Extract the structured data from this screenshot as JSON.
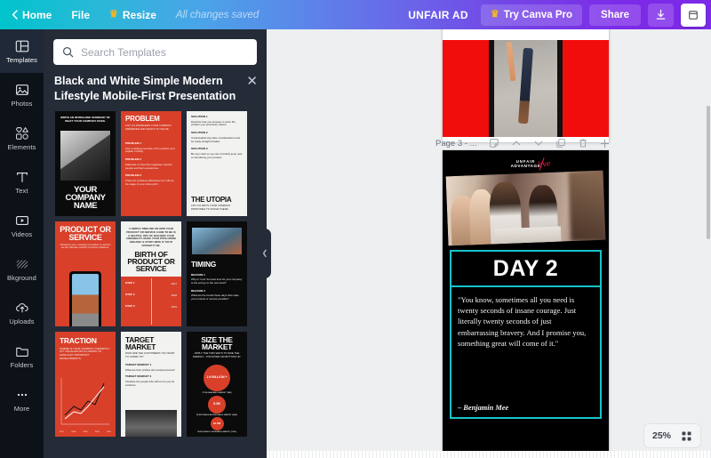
{
  "topbar": {
    "home": "Home",
    "file": "File",
    "resize": "Resize",
    "saved_status": "All changes saved",
    "brand": "UNFAIR AD",
    "try_pro": "Try Canva Pro",
    "share": "Share",
    "crown_icon": "crown-icon",
    "download_icon": "download-icon",
    "back_icon": "chevron-left-icon",
    "more_icon": "window-icon",
    "gradient_start": "#00c4cc",
    "gradient_end": "#7d2ae8"
  },
  "rail": {
    "items": [
      {
        "label": "Templates",
        "icon": "templates-icon",
        "active": true
      },
      {
        "label": "Photos",
        "icon": "photos-icon",
        "active": false
      },
      {
        "label": "Elements",
        "icon": "elements-icon",
        "active": false
      },
      {
        "label": "Text",
        "icon": "text-icon",
        "active": false
      },
      {
        "label": "Videos",
        "icon": "videos-icon",
        "active": false
      },
      {
        "label": "Bkground",
        "icon": "background-icon",
        "active": false
      },
      {
        "label": "Uploads",
        "icon": "uploads-icon",
        "active": false
      },
      {
        "label": "Folders",
        "icon": "folders-icon",
        "active": false
      },
      {
        "label": "More",
        "icon": "more-dots-icon",
        "active": false
      }
    ]
  },
  "panel": {
    "search_placeholder": "Search Templates",
    "search_value": "",
    "search_icon": "search-icon",
    "title": "Black and White Simple Modern Lifestyle Mobile-First Presentation",
    "close_icon": "close-icon",
    "collapse_icon": "chevron-left-icon",
    "templates": [
      {
        "name": "title-slide",
        "style": "black",
        "top_text": "WRITE AN INTRIGUING SUMMARY OF WHAT YOUR COMPANY DOES.",
        "headline": "YOUR COMPANY NAME"
      },
      {
        "name": "problem-slide",
        "style": "red",
        "headline": "PROBLEM",
        "top_text": "LIST 3-5 PROBLEMS YOUR COMPANY OBSERVES AND WANTS TO SOLVE.",
        "items": [
          {
            "label": "PROBLEM 1",
            "body": "Give a striking overview of the problem and explain it briefly."
          },
          {
            "label": "PROBLEM 2",
            "body": "Elaborate on how this negatively impacts people and their experiences."
          },
          {
            "label": "PROBLEM 3",
            "body": "Probe the problems effectively so it will set the stage of your entire pitch."
          }
        ]
      },
      {
        "name": "solution-slide",
        "style": "white",
        "items": [
          {
            "label": "SOLUTION 1",
            "body": "Describe how you propose to solve the problem you previously shared."
          },
          {
            "label": "SOLUTION 2",
            "body": "Contextualize big value considerations and be ready straight forward."
          },
          {
            "label": "SOLUTION 3",
            "body": "Be very clear so you can smoothly jump next to introducing your product."
          }
        ],
        "headline": "THE UTOPIA",
        "bottom_text": "LIST 3-5 WAYS YOUR COMPANY PROPOSES TO SOLVE THESE."
      },
      {
        "name": "product-or-service-slide",
        "style": "red",
        "headline": "PRODUCT OR SERVICE",
        "top_text": "Introduce your company's product or service as the ultimate solution to these problems."
      },
      {
        "name": "birth-of-product-slide",
        "style": "white-red",
        "top_text": "A SIMPLE TIMELINE ON HOW YOUR PRODUCT OR SERVICE CAME TO BE IS A HELPFUL WAY OF BUILDING YOUR CREDIBILITY. MAKE YOUR PITCH MORE ORGANIC & STORY-WISE IF YOU'D RATHER IT BE.",
        "headline": "BIRTH OF PRODUCT OR SERVICE",
        "steps": [
          {
            "label": "STEP 1",
            "year": "2017"
          },
          {
            "label": "STEP 2",
            "year": "2018"
          },
          {
            "label": "STEP 3",
            "year": "2019"
          }
        ]
      },
      {
        "name": "timing-slide",
        "style": "black",
        "headline": "TIMING",
        "items": [
          {
            "label": "REASON 1",
            "body": "Why is \"now\" the best time for your company to the end go to the next level?"
          },
          {
            "label": "REASON 2",
            "body": "What are the trends these days that make your product or service possible?"
          }
        ]
      },
      {
        "name": "traction-slide",
        "style": "red",
        "headline": "TRACTION",
        "top_text": "WHERE IS YOUR COMPANY CURRENTLY AT? VISUALIZE WITH A GRAPH TO HIGHLIGHT IMPORTANT DEVELOPMENTS.",
        "x_labels": [
          "2017",
          "2018",
          "2019",
          "2020",
          "2021"
        ]
      },
      {
        "name": "target-market-slide",
        "style": "white",
        "headline": "TARGET MARKET",
        "top_text": "WHO ARE THE CUSTOMERS YOU WANT TO CATER TO?",
        "items": [
          {
            "label": "TARGET MARKET 1",
            "body": "What are their profiles and usual personas?"
          },
          {
            "label": "TARGET MARKET 2",
            "body": "Visualize the people who will turn to you for solutions."
          }
        ]
      },
      {
        "name": "size-the-market-slide",
        "style": "black",
        "headline": "SIZE THE MARKET",
        "top_text": "APPLY THE TWO WAYS TO SIZE THE MARKET - TOP DOWN OR BOTTOM UP.",
        "bubbles": [
          {
            "value": "1.9 BILLION +",
            "caption": "TOTAL AVAILABLE MARKET (TAM)"
          },
          {
            "value": "8.2M",
            "caption": "SERVICEABLE ADDRESSABLE MARKET (SAM)"
          },
          {
            "value": "10.5M",
            "caption": "SERVICEABLE OBTAINABLE MARKET (SOM)"
          }
        ]
      }
    ]
  },
  "pagebar": {
    "label": "Page 3 - ...",
    "icons": [
      {
        "name": "notes-icon"
      },
      {
        "name": "move-up-icon"
      },
      {
        "name": "move-down-icon"
      },
      {
        "name": "duplicate-page-icon"
      },
      {
        "name": "delete-page-icon"
      },
      {
        "name": "add-page-icon"
      }
    ]
  },
  "slide": {
    "logo_line1": "UNFAIR",
    "logo_line2": "ADVANTAGE",
    "logo_script": "live",
    "day_title": "DAY 2",
    "quote": "\"You know, sometimes all you need is twenty seconds of insane courage. Just literally twenty seconds of just embarrassing bravery. And I promise you, something great will come of it.\"",
    "author": "– Benjamin Mee",
    "accent_color": "#17c3c9",
    "background_color": "#000000"
  },
  "zoom": {
    "level": "25%",
    "grid_icon": "grid-view-icon"
  }
}
